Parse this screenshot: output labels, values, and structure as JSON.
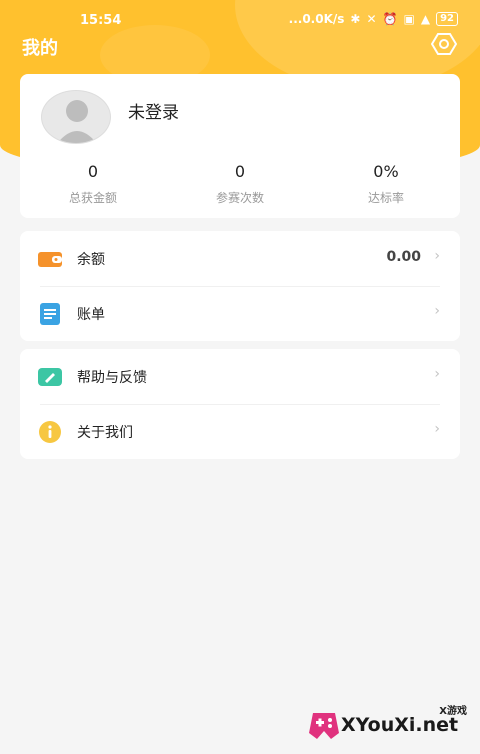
{
  "status_bar": {
    "time": "15:54",
    "network_speed": "...0.0K/s",
    "battery": "92"
  },
  "header": {
    "title": "我的"
  },
  "profile": {
    "login_text": "未登录",
    "stats": [
      {
        "value": "0",
        "label": "总获金额"
      },
      {
        "value": "0",
        "label": "参赛次数"
      },
      {
        "value": "0%",
        "label": "达标率"
      }
    ]
  },
  "menu_group_1": [
    {
      "label": "余额",
      "value": "0.00",
      "icon": "wallet-icon",
      "color": "#f5922b"
    },
    {
      "label": "账单",
      "icon": "bill-icon",
      "color": "#3aa3e3"
    }
  ],
  "menu_group_2": [
    {
      "label": "帮助与反馈",
      "icon": "feedback-icon",
      "color": "#3cc6a4"
    },
    {
      "label": "关于我们",
      "icon": "info-icon",
      "color": "#f7c741"
    }
  ],
  "watermark": {
    "small": "X游戏",
    "big": "XYouXi.net"
  },
  "colors": {
    "accent": "#ffc12e",
    "background": "#f5f5f5"
  }
}
